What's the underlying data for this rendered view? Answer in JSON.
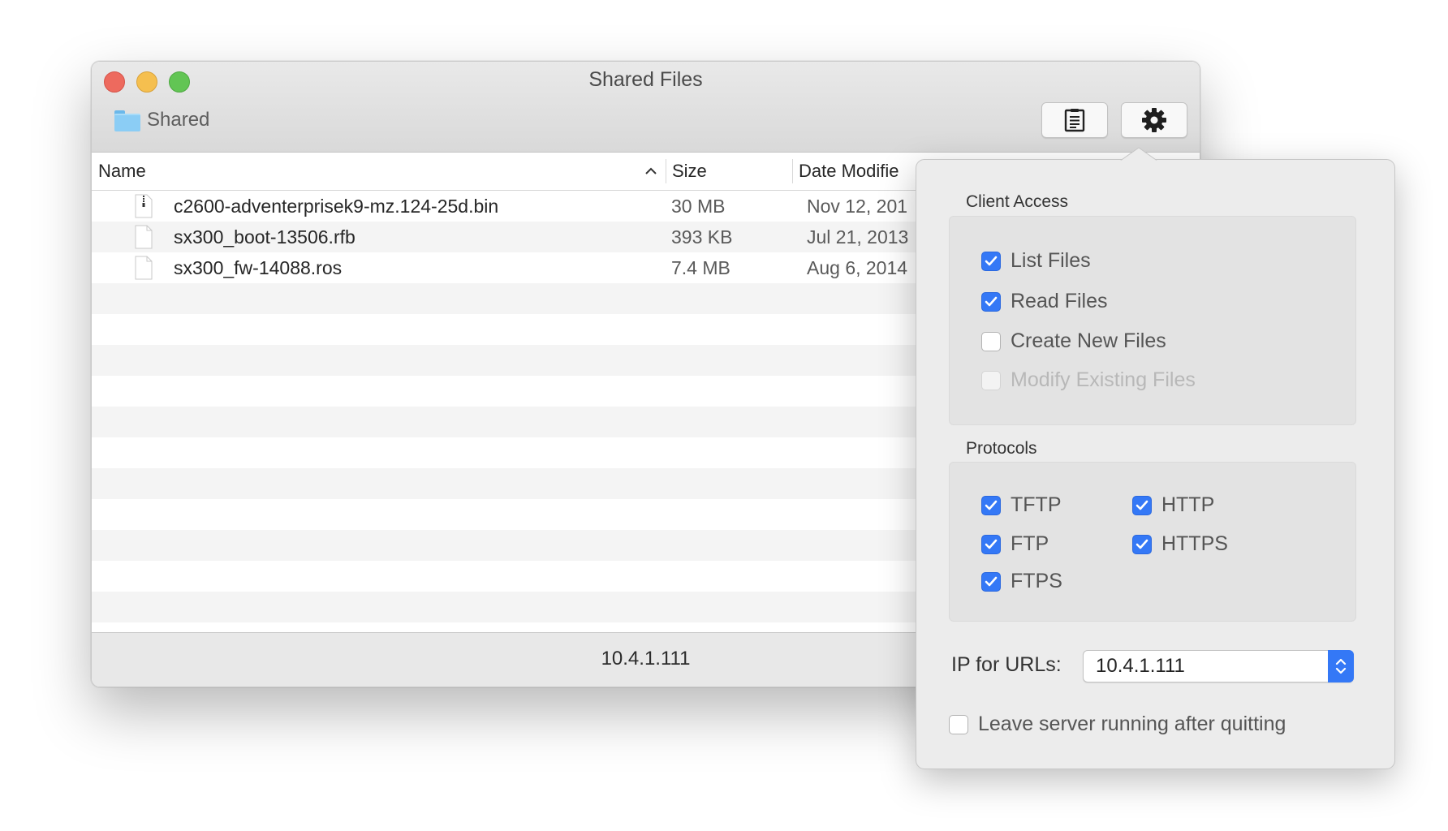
{
  "window": {
    "title": "Shared Files",
    "path_label": "Shared"
  },
  "toolbar": {
    "log_icon": "list-document-icon",
    "gear_icon": "gear-icon"
  },
  "table": {
    "columns": [
      "Name",
      "Size",
      "Date Modifie"
    ],
    "rows": [
      {
        "name": "c2600-adventerprisek9-mz.124-25d.bin",
        "size": "30 MB",
        "date": "Nov 12, 201",
        "icon": "zip-document-icon"
      },
      {
        "name": "sx300_boot-13506.rfb",
        "size": "393 KB",
        "date": "Jul 21, 2013",
        "icon": "document-icon"
      },
      {
        "name": "sx300_fw-14088.ros",
        "size": "7.4 MB",
        "date": "Aug 6, 2014",
        "icon": "document-icon"
      }
    ]
  },
  "status": {
    "ip": "10.4.1.111"
  },
  "popover": {
    "client_access": {
      "label": "Client Access",
      "items": [
        {
          "label": "List Files",
          "checked": true,
          "enabled": true
        },
        {
          "label": "Read Files",
          "checked": true,
          "enabled": true
        },
        {
          "label": "Create New Files",
          "checked": false,
          "enabled": true
        },
        {
          "label": "Modify Existing Files",
          "checked": false,
          "enabled": false
        }
      ]
    },
    "protocols": {
      "label": "Protocols",
      "items": [
        {
          "label": "TFTP",
          "checked": true
        },
        {
          "label": "HTTP",
          "checked": true
        },
        {
          "label": "FTP",
          "checked": true
        },
        {
          "label": "HTTPS",
          "checked": true
        },
        {
          "label": "FTPS",
          "checked": true
        }
      ]
    },
    "ip_for_urls": {
      "label": "IP for URLs:",
      "value": "10.4.1.111"
    },
    "leave_running": {
      "label": "Leave server running after quitting",
      "checked": false
    }
  },
  "colors": {
    "accent": "#3478f6",
    "close": "#ed6a5e",
    "minimize": "#f5bf4f",
    "maximize": "#62c554"
  }
}
